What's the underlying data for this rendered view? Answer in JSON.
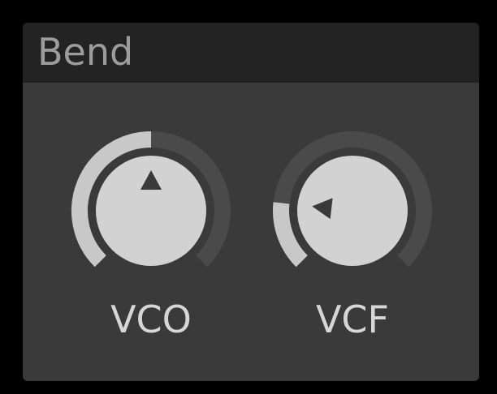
{
  "panel": {
    "title": "Bend"
  },
  "knobs": [
    {
      "label": "VCO",
      "value": 0.5
    },
    {
      "label": "VCF",
      "value": 0.19
    }
  ],
  "colors": {
    "background": "#000000",
    "panel": "#3a3a3a",
    "header": "#232323",
    "title_text": "#9c9c9c",
    "track": "#4a4a4a",
    "arc": "#c8c8c8",
    "knob_face": "#d2d2d2",
    "pointer": "#3a3a3a",
    "label_text": "#d6d6d6"
  },
  "icons": {
    "pointer": "triangle-pointer-icon"
  }
}
